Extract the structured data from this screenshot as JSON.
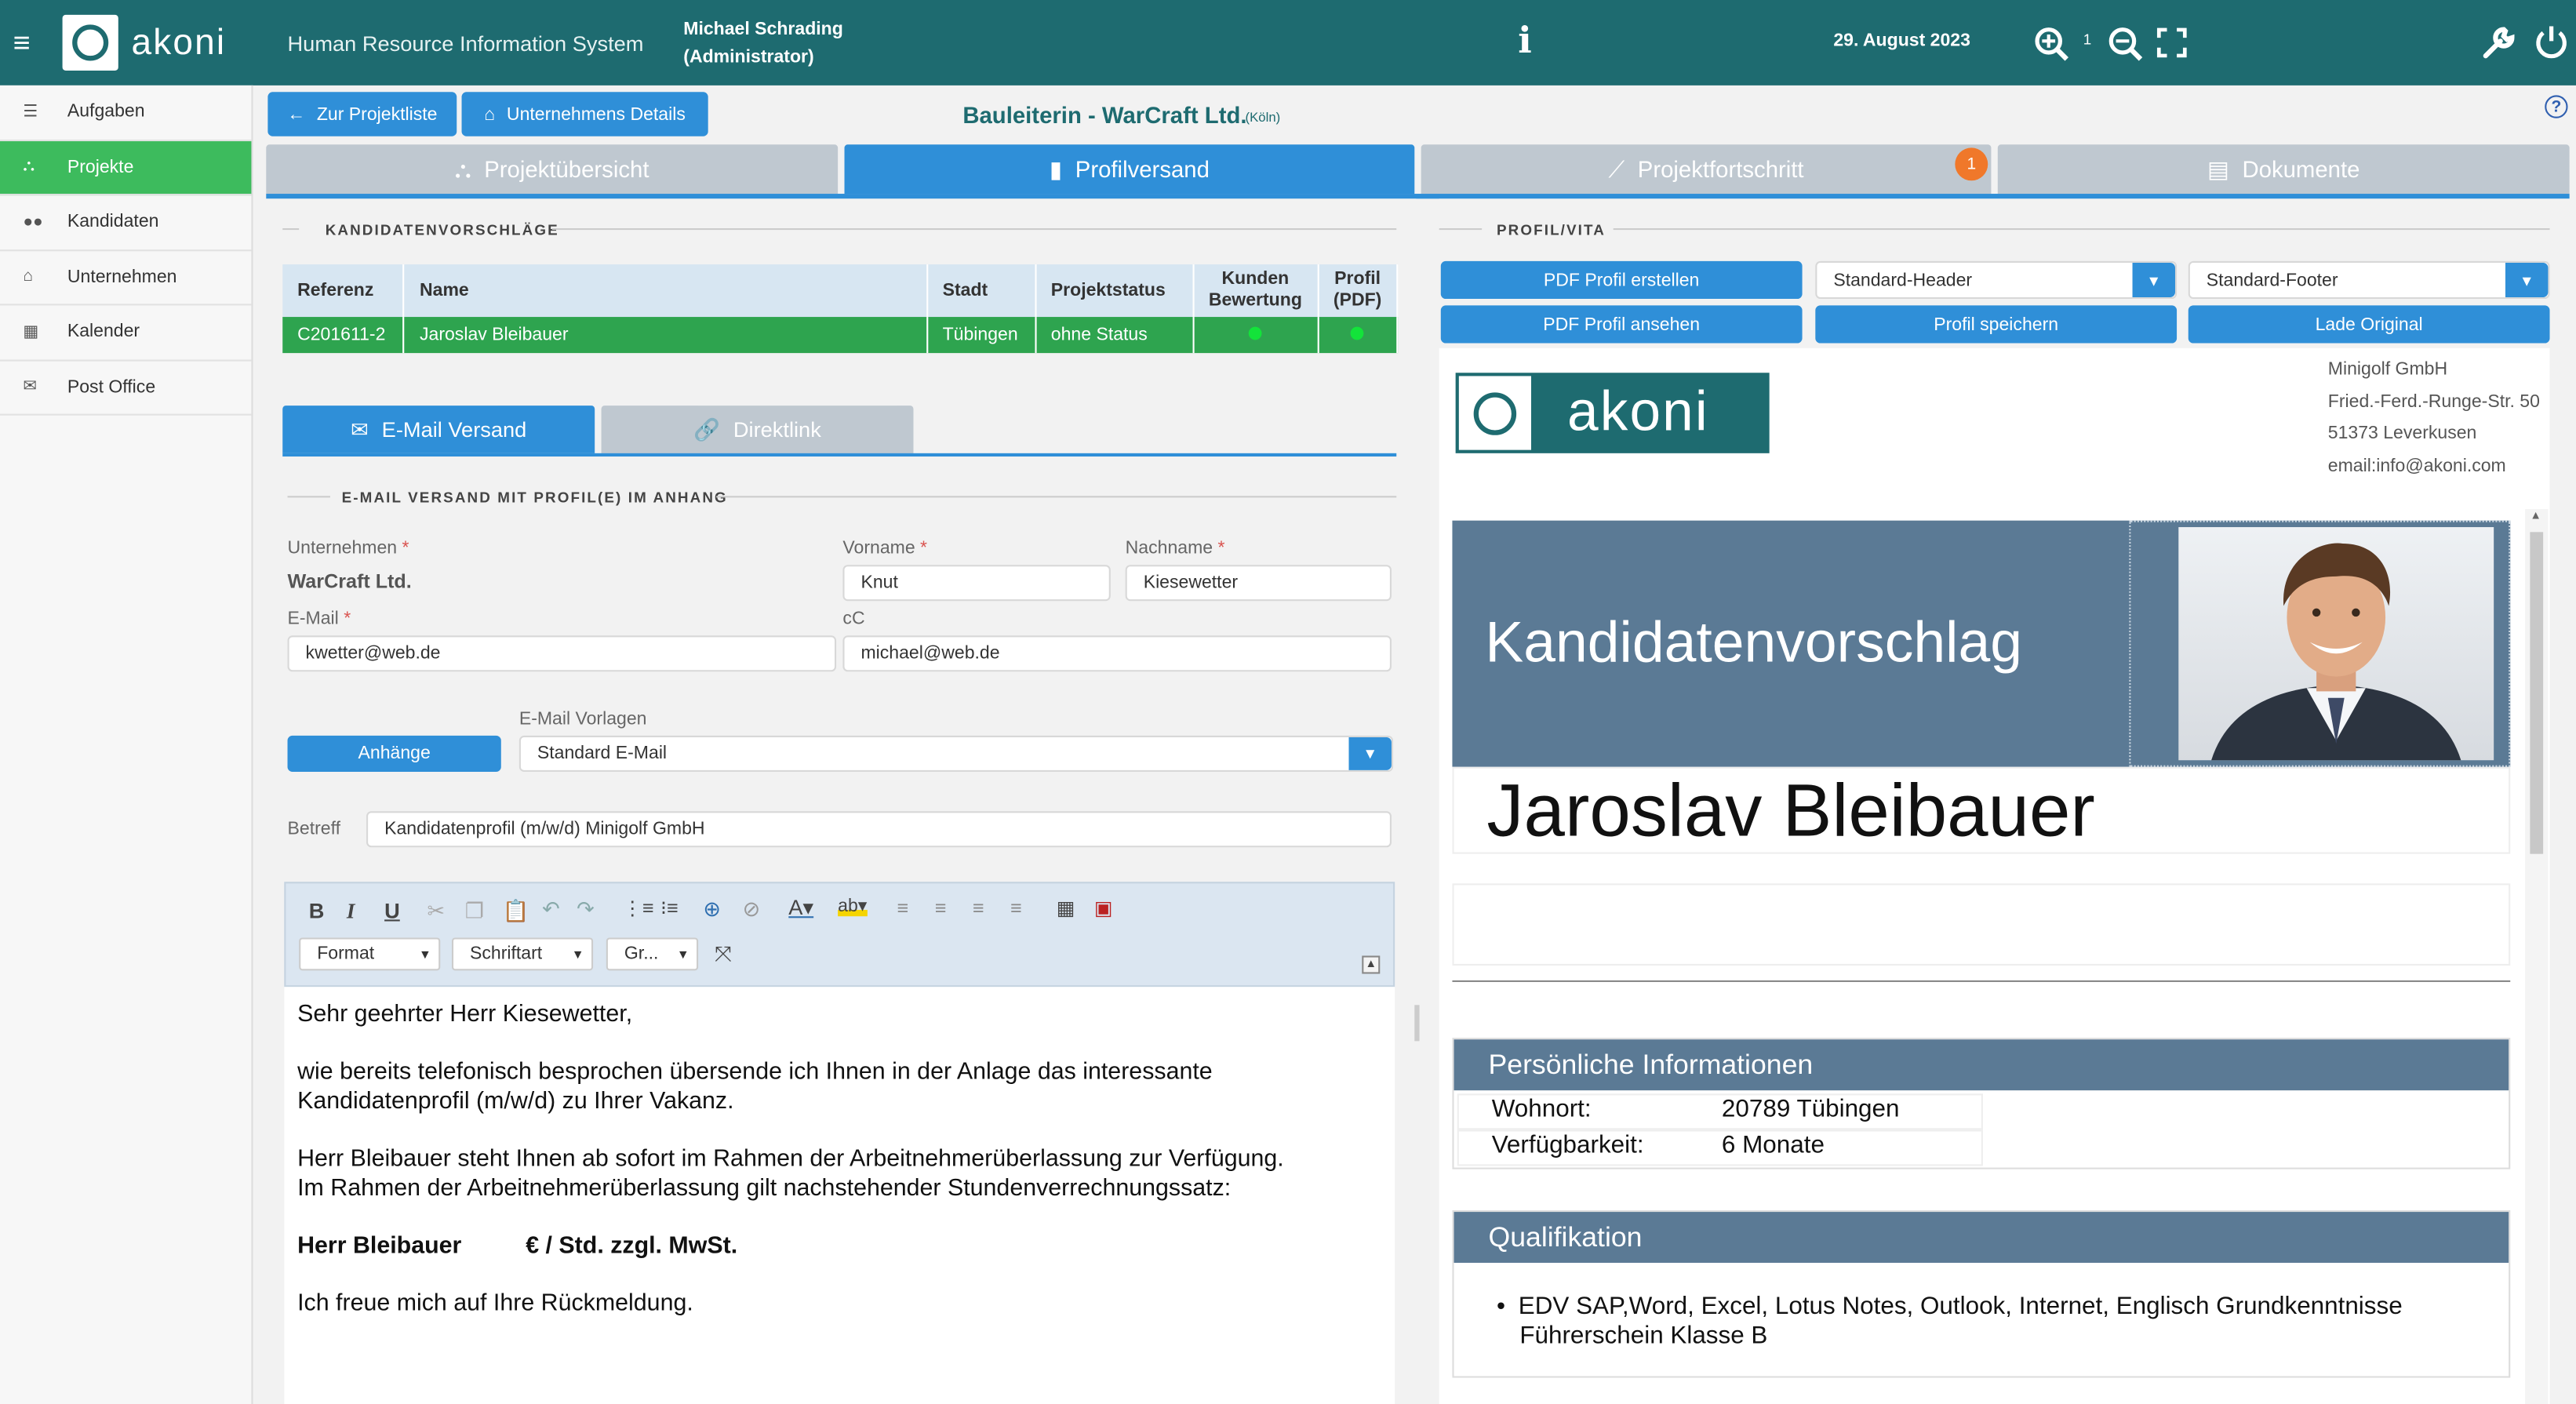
{
  "topbar": {
    "logo_text": "akoni",
    "system_title": "Human Resource Information System",
    "user_name": "Michael Schrading",
    "user_role": "(Administrator)",
    "date": "29. August 2023",
    "zoom_level": "1",
    "icons": [
      "menu-icon",
      "info-icon",
      "zoom-in-icon",
      "zoom-out-icon",
      "fullscreen-icon",
      "wrench-icon",
      "power-icon"
    ]
  },
  "sidebar": {
    "items": [
      {
        "label": "Aufgaben",
        "icon": "list-icon"
      },
      {
        "label": "Projekte",
        "icon": "sitemap-icon",
        "active": true
      },
      {
        "label": "Kandidaten",
        "icon": "users-icon"
      },
      {
        "label": "Unternehmen",
        "icon": "bank-icon"
      },
      {
        "label": "Kalender",
        "icon": "calendar-icon"
      },
      {
        "label": "Post Office",
        "icon": "envelope-icon"
      }
    ]
  },
  "header": {
    "back_button": "Zur Projektliste",
    "company_button": "Unternehmens Details",
    "project_title": "Bauleiterin - WarCraft Ltd.",
    "project_city": "(Köln)"
  },
  "tabs": [
    {
      "label": "Projektübersicht"
    },
    {
      "label": "Profilversand",
      "active": true
    },
    {
      "label": "Projektfortschritt",
      "badge": "1"
    },
    {
      "label": "Dokumente"
    }
  ],
  "candidates": {
    "section_title": "KANDIDATENVORSCHLÄGE",
    "columns": [
      "Referenz",
      "Name",
      "Stadt",
      "Projektstatus",
      "Kunden Bewertung",
      "Profil (PDF)"
    ],
    "rows": [
      {
        "referenz": "C201611-2",
        "name": "Jaroslav Bleibauer",
        "stadt": "Tübingen",
        "status": "ohne Status"
      }
    ]
  },
  "mail_tabs": {
    "email": "E-Mail Versand",
    "direct": "Direktlink"
  },
  "mail_form": {
    "section_title": "E-MAIL VERSAND MIT PROFIL(E) IM ANHANG",
    "company_label": "Unternehmen",
    "company_value": "WarCraft Ltd.",
    "firstname_label": "Vorname",
    "firstname_value": "Knut",
    "lastname_label": "Nachname",
    "lastname_value": "Kiesewetter",
    "email_label": "E-Mail",
    "email_value": "kwetter@web.de",
    "cc_label": "cC",
    "cc_value": "michael@web.de",
    "attachments_button": "Anhänge",
    "template_label": "E-Mail Vorlagen",
    "template_value": "Standard E-Mail",
    "subject_label": "Betreff",
    "subject_value": "Kandidatenprofil (m/w/d) Minigolf GmbH"
  },
  "editor": {
    "format_label": "Format",
    "font_label": "Schriftart",
    "size_label": "Gr...",
    "body": {
      "greeting": "Sehr geehrter Herr Kiesewetter,",
      "p1a": "wie bereits telefonisch besprochen übersende ich Ihnen in der Anlage das interessante",
      "p1b": "Kandidatenprofil (m/w/d) zu Ihrer Vakanz.",
      "p2a": "Herr Bleibauer steht Ihnen ab sofort im Rahmen der Arbeitnehmerüberlassung zur Verfügung.",
      "p2b": "Im Rahmen der Arbeitnehmerüberlassung gilt nachstehender Stundenverrechnungssatz:",
      "rate_name": "Herr Bleibauer",
      "rate_value": "€ / Std. zzgl. MwSt.",
      "closing": "Ich freue mich auf Ihre Rückmeldung."
    }
  },
  "profile": {
    "section_title": "PROFIL/VITA",
    "btn_create": "PDF Profil erstellen",
    "btn_view": "PDF Profil ansehen",
    "header_select": "Standard-Header",
    "footer_select": "Standard-Footer",
    "btn_save": "Profil speichern",
    "btn_original": "Lade Original",
    "company_name": "Minigolf GmbH",
    "company_street": "Fried.-Ferd.-Runge-Str. 50",
    "company_city": "51373 Leverkusen",
    "company_email": "email:info@akoni.com",
    "vita_title": "Kandidatenvorschlag",
    "candidate_name": "Jaroslav Bleibauer",
    "personal_title": "Persönliche Informationen",
    "wohnort_label": "Wohnort:",
    "wohnort_value": "20789 Tübingen",
    "verf_label": "Verfügbarkeit:",
    "verf_value": "6 Monate",
    "qual_title": "Qualifikation",
    "qual_1": "EDV SAP,Word, Excel, Lotus Notes, Outlook, Internet, Englisch Grundkenntnisse",
    "qual_2": "Führerschein Klasse B"
  },
  "colors": {
    "topbar": "#1e6b70",
    "accent_blue": "#2f8fd8",
    "active_green": "#3dbb5d",
    "vita_blue": "#5b7a95"
  }
}
